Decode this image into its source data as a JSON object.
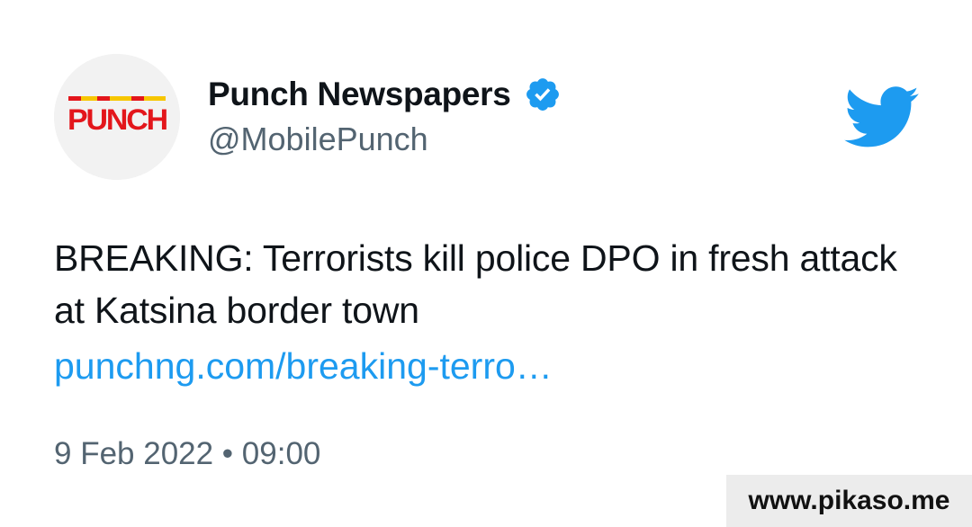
{
  "author": {
    "display_name": "Punch Newspapers",
    "handle": "@MobilePunch",
    "verified": true,
    "avatar_logo_text": "PUNCH"
  },
  "tweet": {
    "text": "BREAKING: Terrorists kill police DPO in fresh attack at Katsina border town",
    "link_text": "punchng.com/breaking-terro…",
    "timestamp": "9 Feb 2022 • 09:00"
  },
  "icons": {
    "verified": "verified-badge-icon",
    "platform": "twitter-bird-icon"
  },
  "colors": {
    "link": "#1d9bf0",
    "verified": "#1d9bf0",
    "bird": "#1d9bf0",
    "text": "#0f1419",
    "muted": "#536471",
    "logo_red": "#e3161b",
    "logo_yellow": "#f7c600"
  },
  "watermark": {
    "text": "www.pikaso.me"
  }
}
